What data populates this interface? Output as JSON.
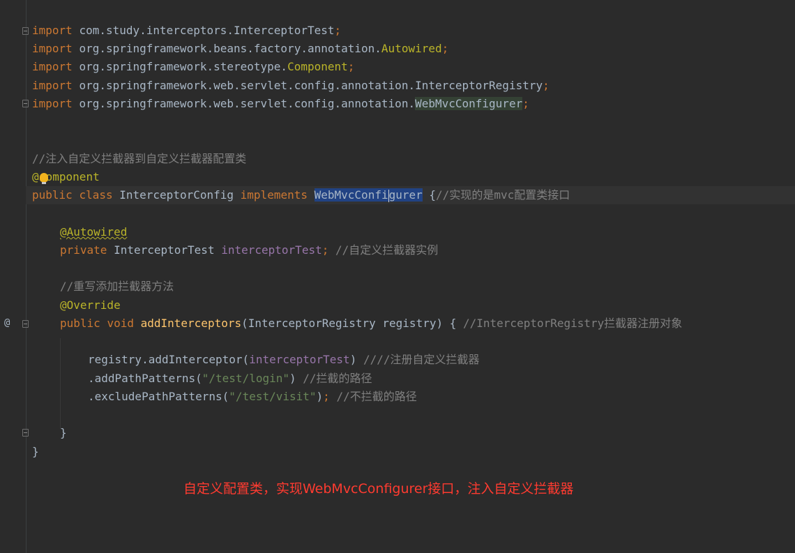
{
  "code": {
    "imports": [
      {
        "keyword": "import",
        "path": "com.study.interceptors.",
        "name": "InterceptorTest",
        "semi": ";"
      },
      {
        "keyword": "import",
        "path": "org.springframework.beans.factory.annotation.",
        "name": "Autowired",
        "semi": ";"
      },
      {
        "keyword": "import",
        "path": "org.springframework.stereotype.",
        "name": "Component",
        "semi": ";"
      },
      {
        "keyword": "import",
        "path": "org.springframework.web.servlet.config.annotation.",
        "name": "InterceptorRegistry",
        "semi": ";"
      },
      {
        "keyword": "import",
        "path": "org.springframework.web.servlet.config.annotation.",
        "name": "WebMvcConfigurer",
        "semi": ";"
      }
    ],
    "class_comment": "//注入自定义拦截器到自定义拦截器配置类",
    "component_annotation": {
      "at": "@",
      "rest": "omponent"
    },
    "class_decl": {
      "public": "public",
      "class_kw": "class",
      "name": "InterceptorConfig",
      "implements": "implements",
      "iface_a": "WebMvcConfi",
      "iface_b": "gurer",
      "brace": "{",
      "comment": "//实现的是mvc配置类接口"
    },
    "autowired": "@Autowired",
    "field": {
      "private": "private",
      "type": "InterceptorTest",
      "name": "interceptorTest",
      "semi": ";",
      "comment": "//自定义拦截器实例"
    },
    "method_comment": "//重写添加拦截器方法",
    "override": "@Override",
    "method_decl": {
      "public": "public",
      "void": "void",
      "name": "addInterceptors",
      "params": "(InterceptorRegistry registry) {",
      "comment": "//InterceptorRegistry拦截器注册对象"
    },
    "body": {
      "line1_pre": "registry.addInterceptor(",
      "line1_arg": "interceptorTest",
      "line1_post": ")",
      "line1_comment": "////注册自定义拦截器",
      "line2_pre": ".addPathPatterns(",
      "line2_str": "\"/test/login\"",
      "line2_post": ")",
      "line2_comment": "//拦截的路径",
      "line3_pre": ".excludePathPatterns(",
      "line3_str": "\"/test/visit\"",
      "line3_post": ")",
      "line3_semi": ";",
      "line3_comment": "//不拦截的路径"
    },
    "method_close": "}",
    "class_close": "}"
  },
  "gutter": {
    "override_marker": "@"
  },
  "caption": "自定义配置类，实现WebMvcConfigurer接口，注入自定义拦截器",
  "colors": {
    "background": "#2b2b2b",
    "keyword": "#cc7832",
    "annotation": "#bbb529",
    "comment": "#808080",
    "string": "#6a8759",
    "field": "#9876aa",
    "method": "#ffc66d",
    "text": "#a9b7c6",
    "caption": "#ff3b30"
  },
  "icons": [
    "fold-marker-icon",
    "lightbulb-icon",
    "override-gutter-icon"
  ]
}
